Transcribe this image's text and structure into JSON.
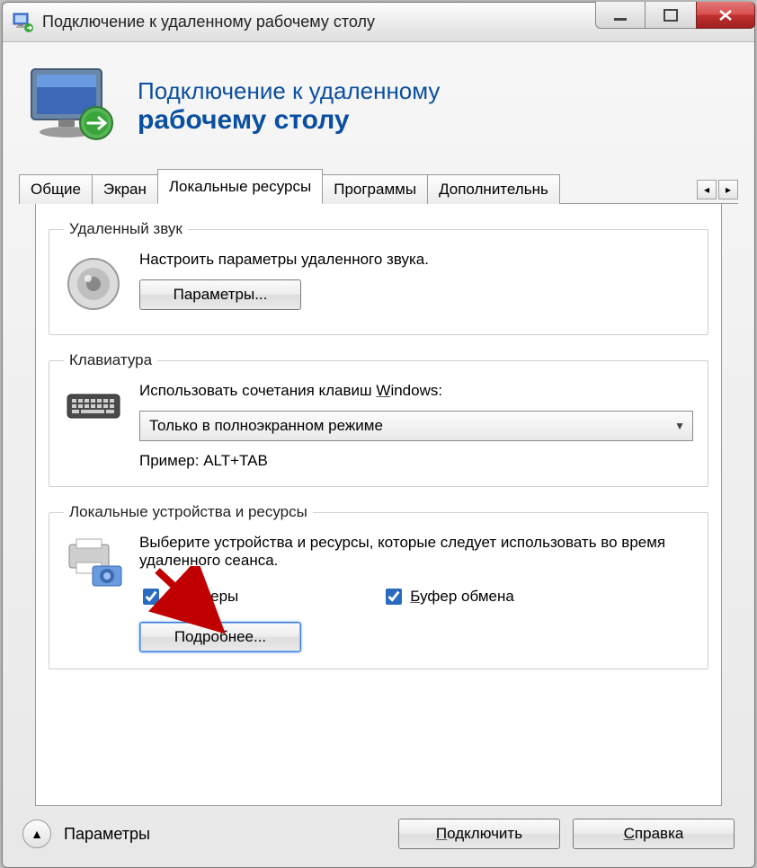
{
  "window_title": "Подключение к удаленному рабочему столу",
  "header": {
    "line1": "Подключение к удаленному",
    "line2": "рабочему столу"
  },
  "tabs": {
    "items": [
      "Общие",
      "Экран",
      "Локальные ресурсы",
      "Программы",
      "Дополнительнь"
    ],
    "active_index": 2
  },
  "groups": {
    "audio": {
      "legend": "Удаленный звук",
      "desc": "Настроить параметры удаленного звука.",
      "button": "Параметры..."
    },
    "keyboard": {
      "legend": "Клавиатура",
      "desc_prefix": "Использовать сочетания клавиш ",
      "desc_under": "W",
      "desc_suffix": "indows:",
      "combo_value": "Только в полноэкранном режиме",
      "example": "Пример: ALT+TAB"
    },
    "devices": {
      "legend": "Локальные устройства и ресурсы",
      "desc": "Выберите устройства и ресурсы, которые следует использовать во время удаленного сеанса.",
      "check_printers_prefix": "П",
      "check_printers_rest": "ринтеры",
      "check_clipboard_prefix": "Б",
      "check_clipboard_rest": "уфер обмена",
      "button": "Подробнее..."
    }
  },
  "footer": {
    "options": "Параметры",
    "connect_prefix": "П",
    "connect_rest": "одключить",
    "help_prefix": "С",
    "help_rest": "правка"
  },
  "icons": {
    "app": "rdc-app-icon",
    "monitor": "monitor-icon",
    "speaker": "speaker-icon",
    "keyboard": "keyboard-icon",
    "devices": "printer-camera-icon"
  }
}
